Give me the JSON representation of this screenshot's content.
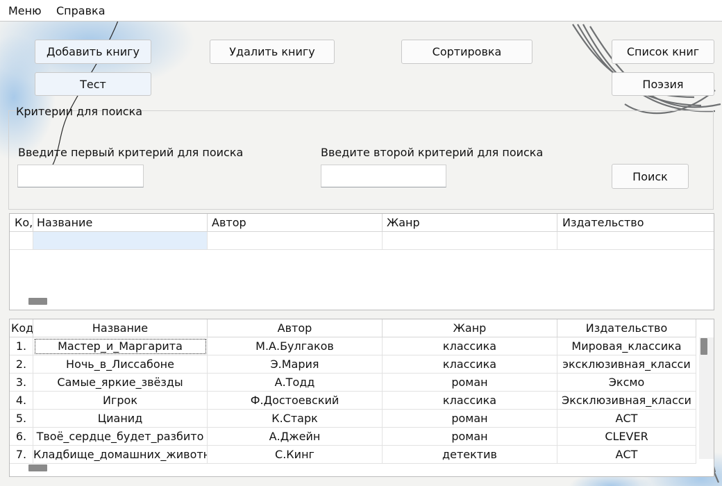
{
  "menu": {
    "items": [
      "Меню",
      "Справка"
    ]
  },
  "buttons": {
    "add_book": "Добавить книгу",
    "delete_book": "Удалить книгу",
    "sort": "Сортировка",
    "book_list": "Список книг",
    "test": "Тест",
    "poetry": "Поэзия",
    "search": "Поиск"
  },
  "search": {
    "group_title": "Критерии для поиска",
    "first_label": "Введите первый критерий для поиска",
    "second_label": "Введите второй критерий для поиска",
    "first_value": "",
    "second_value": ""
  },
  "results_table": {
    "columns": [
      "Ко,",
      "Название",
      "Автор",
      "Жанр",
      "Издательство"
    ],
    "rows": [
      [
        "",
        "",
        "",
        "",
        ""
      ]
    ]
  },
  "books_table": {
    "columns": [
      "Код",
      "Название",
      "Автор",
      "Жанр",
      "Издательство"
    ],
    "rows": [
      [
        "1.",
        "Мастер_и_Маргарита",
        "М.А.Булгаков",
        "классика",
        "Мировая_классика"
      ],
      [
        "2.",
        "Ночь_в_Лиссабоне",
        "Э.Мария",
        "классика",
        "эксклюзивная_класси"
      ],
      [
        "3.",
        "Самые_яркие_звёзды",
        "А.Тодд",
        "роман",
        "Эксмо"
      ],
      [
        "4.",
        "Игрок",
        "Ф.Достоевский",
        "классика",
        "Эксклюзивная_класси"
      ],
      [
        "5.",
        "Цианид",
        "К.Старк",
        "роман",
        "АСТ"
      ],
      [
        "6.",
        "Твоё_сердце_будет_разбито",
        "А.Джейн",
        "роман",
        "CLEVER"
      ],
      [
        "7.",
        "Кладбище_домашних_животных",
        "С.Кинг",
        "детектив",
        "АСТ"
      ]
    ]
  },
  "colors": {
    "accent_blue": "#9cc3e8",
    "line_gray": "#6f7173"
  }
}
